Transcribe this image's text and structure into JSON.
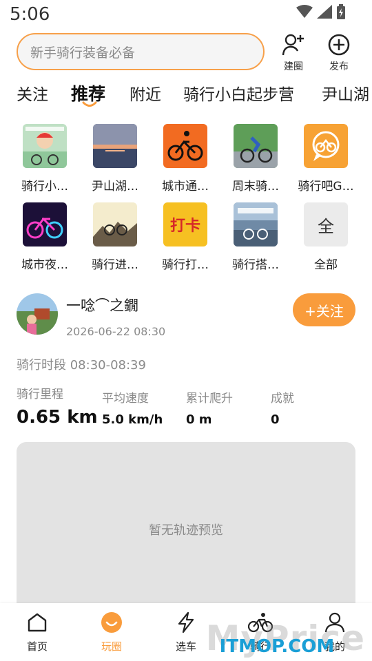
{
  "status_bar": {
    "time": "5:06"
  },
  "header": {
    "search_placeholder": "新手骑行装备必备",
    "create_circle_label": "建圈",
    "publish_label": "发布"
  },
  "tabs": [
    {
      "label": "关注"
    },
    {
      "label": "推荐",
      "active": true
    },
    {
      "label": "附近"
    },
    {
      "label": "骑行小白起步营"
    },
    {
      "label": "尹山湖"
    }
  ],
  "circles": [
    {
      "label": "骑行小…"
    },
    {
      "label": "尹山湖…"
    },
    {
      "label": "城市通…"
    },
    {
      "label": "周末骑…"
    },
    {
      "label": "骑行吧G…"
    },
    {
      "label": "城市夜…"
    },
    {
      "label": "骑行进…"
    },
    {
      "label": "骑行打…",
      "thumb_text": "打卡"
    },
    {
      "label": "骑行搭…"
    },
    {
      "label": "全部",
      "thumb_text": "全"
    }
  ],
  "post": {
    "username": "一唸⌒之鐗",
    "time": "2026-06-22 08:30",
    "follow_label": "+关注",
    "period": "骑行时段 08:30-08:39",
    "stats": [
      {
        "label": "骑行里程",
        "value": "0.65 km"
      },
      {
        "label": "平均速度",
        "value": "5.0 km/h"
      },
      {
        "label": "累计爬升",
        "value": "0 m"
      },
      {
        "label": "成就",
        "value": "0"
      }
    ],
    "map_empty_text": "暂无轨迹预览"
  },
  "bottom_nav": [
    {
      "label": "首页"
    },
    {
      "label": "玩圈",
      "active": true
    },
    {
      "label": "选车"
    },
    {
      "label": "骑行"
    },
    {
      "label": "我的"
    }
  ],
  "watermark": {
    "text": "MyPrice",
    "site": "ITMOP.COM"
  },
  "colors": {
    "accent": "#f99c3c",
    "search_border": "#f7a04a",
    "muted": "#8a8a8a"
  }
}
